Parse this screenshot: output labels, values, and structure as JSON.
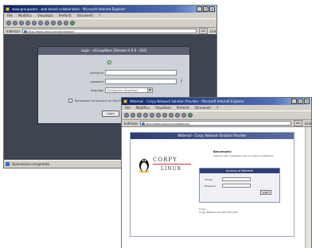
{
  "window1": {
    "title": "www.groupware - web based collaboration - Microsoft Internet Explorer",
    "menu": [
      "File",
      "Modifica",
      "Visualizza",
      "Preferiti",
      "Strumenti",
      "?"
    ],
    "address_label": "Indirizzo",
    "address": "http://www.corpy.com/groupware/",
    "go_label": "Vai",
    "links_label": "Link",
    "login": {
      "header": "Login - eGroupWare [Release 0.9.9 - 002]",
      "username_label": "username",
      "password_label": "password",
      "language_label": "language",
      "language_value": "Portuguese (Brazilian)",
      "remember_label": "Remember my account on this PC",
      "login_button": "Login"
    },
    "status": "Operazione completata"
  },
  "window2": {
    "title": "Webmail - Corpy Network Solution Provider - Microsoft Internet Explorer",
    "menu": [
      "File",
      "Modifica",
      "Visualizza",
      "Preferiti",
      "Strumenti",
      "?"
    ],
    "address_label": "Indirizzo",
    "address": "http://www.corpy.com/webmail/",
    "go_label": "Vai",
    "links_label": "Link",
    "webmail": {
      "header": "Webmail - Corpy Network Solution Provider",
      "logo_top": "CORPY",
      "logo_bottom": "LINUX",
      "welcome_title": "Benvenuto!",
      "welcome_text": "Inserire user e password per accedere al webmail.",
      "access_header": "Accesso ai Webmail",
      "user_label": "Utente",
      "password_label": "Password",
      "login_button": "Login",
      "footer_line1": "Corpy",
      "footer_line2": "Corpy Network Solution Provider"
    }
  },
  "colors": {
    "titlebar_start": "#0a246a",
    "eg_background": "#3e4550",
    "webmail_header": "#2e3e72"
  }
}
